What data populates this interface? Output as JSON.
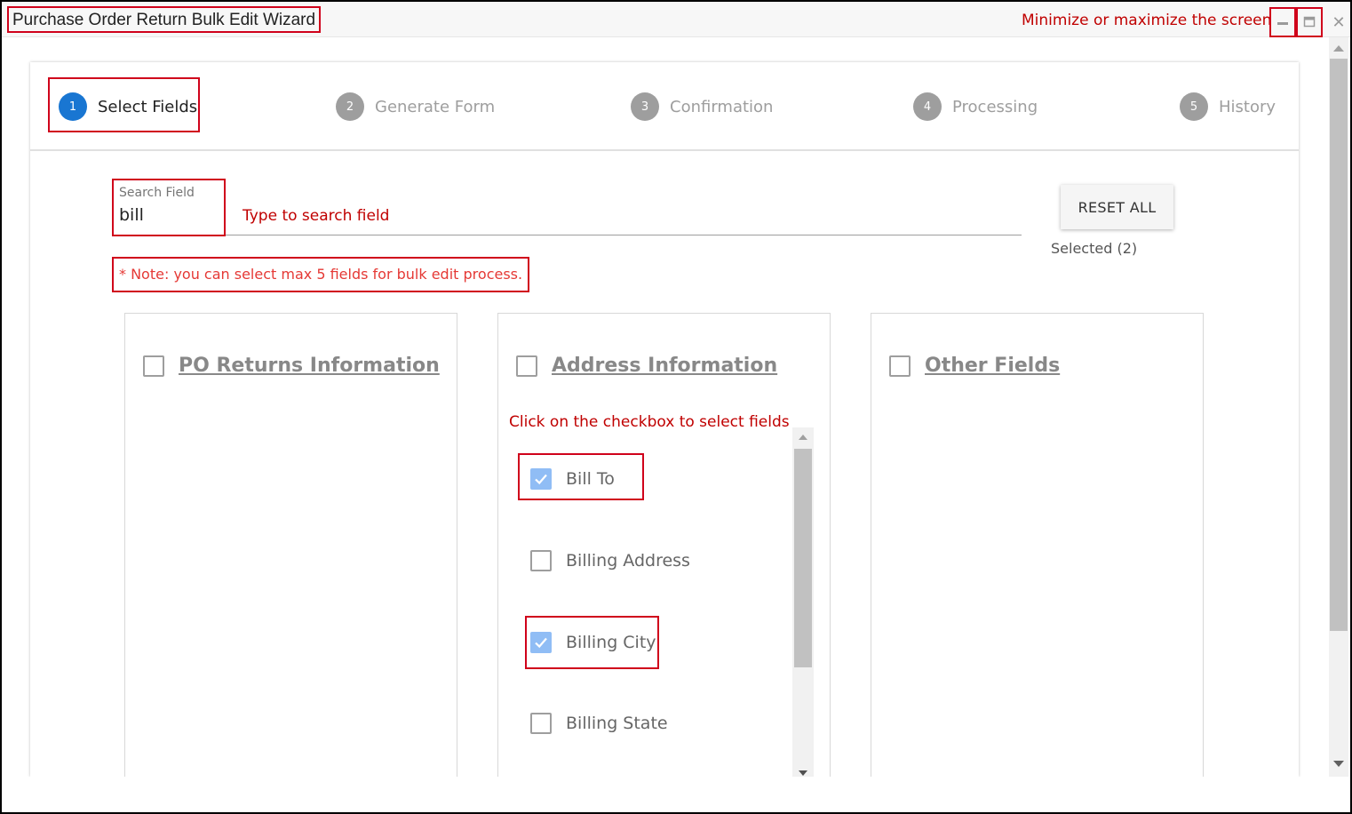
{
  "window": {
    "title": "Purchase Order Return Bulk Edit Wizard",
    "annotation_minmax": "Minimize or maximize the screen",
    "minimize_icon": "minimize-icon",
    "maximize_icon": "maximize-icon",
    "close_icon": "close-icon",
    "close_glyph": "✕"
  },
  "stepper": {
    "steps": [
      {
        "number": "1",
        "label": "Select Fields",
        "active": true
      },
      {
        "number": "2",
        "label": "Generate Form",
        "active": false
      },
      {
        "number": "3",
        "label": "Confirmation",
        "active": false
      },
      {
        "number": "4",
        "label": "Processing",
        "active": false
      },
      {
        "number": "5",
        "label": "History",
        "active": false
      }
    ]
  },
  "search": {
    "label": "Search Field",
    "value": "bill",
    "annotation": "Type to search field"
  },
  "actions": {
    "reset_label": "RESET ALL",
    "selected_text": "Selected (2)"
  },
  "note": "* Note: you can select max 5 fields for bulk edit process.",
  "groups": [
    {
      "title": "PO Returns Information",
      "checked": false
    },
    {
      "title": "Address Information",
      "checked": false,
      "annotation": "Click on the checkbox to select fields",
      "fields": [
        {
          "name": "Bill To",
          "checked": true
        },
        {
          "name": "Billing Address",
          "checked": false
        },
        {
          "name": "Billing City",
          "checked": true
        },
        {
          "name": "Billing State",
          "checked": false
        }
      ]
    },
    {
      "title": "Other Fields",
      "checked": false
    }
  ],
  "colors": {
    "annotation_red": "#d0021b",
    "active_step": "#1976d2",
    "inactive_step": "#9e9e9e",
    "checked_box": "#90bdf5",
    "note_text": "#e53935"
  }
}
